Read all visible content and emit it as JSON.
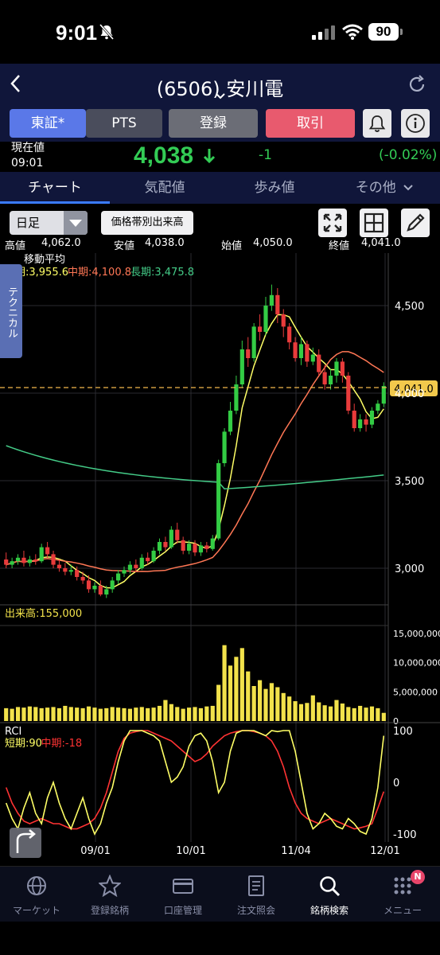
{
  "status": {
    "time": "9:01",
    "battery": "90"
  },
  "nav": {
    "title": "(6506) 安川電"
  },
  "buttons": {
    "tosho": "東証*",
    "pts": "PTS",
    "register": "登録",
    "trade": "取引"
  },
  "quote": {
    "label": "現在値",
    "time": "09:01",
    "price": "4,038",
    "change": "-1",
    "change_pct": "(-0.02%)"
  },
  "tabs": [
    "チャート",
    "気配値",
    "歩み値",
    "その他"
  ],
  "toolbar": {
    "period": "日足",
    "volume_profile": "価格帯別出来高"
  },
  "ohlc": {
    "high_label": "高値",
    "high": "4,062.0",
    "low_label": "安値",
    "low": "4,038.0",
    "open_label": "始値",
    "open": "4,050.0",
    "close_label": "終値",
    "close": "4,041.0"
  },
  "side_tab": "テクニカル",
  "chart_data": {
    "type": "candlestick",
    "ma_title": "移動平均",
    "ma_legend": [
      {
        "label": "短期:3,955.6",
        "color": "#ffff66"
      },
      {
        "label": "中期:4,100.8",
        "color": "#ff7755"
      },
      {
        "label": "長期:3,475.8",
        "color": "#44cc88"
      }
    ],
    "price_axis": [
      "4,500",
      "4,000",
      "3,500",
      "3,000"
    ],
    "price_range": [
      2800,
      4800
    ],
    "current_price_tag": "4,041.0",
    "x_labels": [
      "09/01",
      "10/01",
      "11/04",
      "12/01"
    ],
    "candles": [
      [
        3050,
        3020,
        3090,
        3000
      ],
      [
        3020,
        3040,
        3060,
        3000
      ],
      [
        3040,
        3060,
        3080,
        3020
      ],
      [
        3060,
        3030,
        3100,
        3010
      ],
      [
        3030,
        3050,
        3070,
        3010
      ],
      [
        3050,
        3040,
        3080,
        3020
      ],
      [
        3040,
        3120,
        3140,
        3030
      ],
      [
        3120,
        3080,
        3150,
        3060
      ],
      [
        3080,
        3020,
        3100,
        3000
      ],
      [
        3020,
        3000,
        3050,
        2980
      ],
      [
        3000,
        2980,
        3030,
        2960
      ],
      [
        2980,
        2990,
        3020,
        2960
      ],
      [
        2990,
        2950,
        3010,
        2930
      ],
      [
        2950,
        2930,
        2980,
        2910
      ],
      [
        2930,
        2880,
        2960,
        2860
      ],
      [
        2880,
        2900,
        2920,
        2860
      ],
      [
        2900,
        2850,
        2930,
        2840
      ],
      [
        2850,
        2880,
        2900,
        2830
      ],
      [
        2880,
        2930,
        2950,
        2860
      ],
      [
        2930,
        2970,
        2990,
        2910
      ],
      [
        2970,
        2990,
        3010,
        2950
      ],
      [
        2990,
        3020,
        3040,
        2970
      ],
      [
        3020,
        3000,
        3050,
        2980
      ],
      [
        3000,
        3060,
        3080,
        2990
      ],
      [
        3060,
        3040,
        3090,
        3020
      ],
      [
        3040,
        3100,
        3120,
        3030
      ],
      [
        3100,
        3150,
        3170,
        3080
      ],
      [
        3150,
        3120,
        3180,
        3100
      ],
      [
        3120,
        3220,
        3240,
        3110
      ],
      [
        3220,
        3160,
        3260,
        3140
      ],
      [
        3160,
        3100,
        3180,
        3080
      ],
      [
        3100,
        3140,
        3160,
        3080
      ],
      [
        3140,
        3090,
        3160,
        3070
      ],
      [
        3090,
        3130,
        3150,
        3070
      ],
      [
        3130,
        3110,
        3150,
        3090
      ],
      [
        3110,
        3170,
        3190,
        3100
      ],
      [
        3170,
        3600,
        3620,
        3160
      ],
      [
        3600,
        3780,
        3800,
        3580
      ],
      [
        3780,
        3900,
        3950,
        3760
      ],
      [
        3900,
        4050,
        4100,
        3880
      ],
      [
        4050,
        4250,
        4300,
        4030
      ],
      [
        4250,
        4200,
        4320,
        4150
      ],
      [
        4200,
        4380,
        4400,
        4180
      ],
      [
        4380,
        4350,
        4450,
        4300
      ],
      [
        4350,
        4500,
        4550,
        4330
      ],
      [
        4500,
        4560,
        4620,
        4470
      ],
      [
        4560,
        4450,
        4600,
        4400
      ],
      [
        4450,
        4380,
        4480,
        4320
      ],
      [
        4380,
        4290,
        4400,
        4250
      ],
      [
        4290,
        4200,
        4320,
        4180
      ],
      [
        4200,
        4280,
        4320,
        4160
      ],
      [
        4280,
        4180,
        4300,
        4150
      ],
      [
        4180,
        4220,
        4260,
        4160
      ],
      [
        4220,
        4120,
        4250,
        4100
      ],
      [
        4120,
        4050,
        4160,
        4020
      ],
      [
        4050,
        4100,
        4140,
        4020
      ],
      [
        4100,
        4180,
        4200,
        4060
      ],
      [
        4180,
        4100,
        4200,
        4060
      ],
      [
        4100,
        3900,
        4120,
        3880
      ],
      [
        3900,
        3800,
        3940,
        3780
      ],
      [
        3800,
        3850,
        3880,
        3780
      ],
      [
        3850,
        3820,
        3880,
        3780
      ],
      [
        3820,
        3900,
        3920,
        3800
      ],
      [
        3900,
        3940,
        3960,
        3880
      ],
      [
        3940,
        4041,
        4062,
        3920
      ]
    ],
    "volume_label": "出来高:155,000",
    "volume_axis": [
      "15,000,000",
      "10,000,000",
      "5,000,000",
      "0"
    ],
    "volume_max": 15000000,
    "rci_label": "RCI",
    "rci_legend": [
      {
        "label": "短期:90",
        "color": "#ffff66"
      },
      {
        "label": "中期:-18",
        "color": "#ff3333"
      }
    ],
    "rci_axis": [
      "100",
      "0",
      "-100"
    ]
  },
  "bottom_nav": [
    {
      "label": "マーケット",
      "icon": "globe-icon"
    },
    {
      "label": "登録銘柄",
      "icon": "star-icon"
    },
    {
      "label": "口座管理",
      "icon": "card-icon"
    },
    {
      "label": "注文照会",
      "icon": "document-icon"
    },
    {
      "label": "銘柄検索",
      "icon": "search-icon"
    },
    {
      "label": "メニュー",
      "icon": "menu-grid-icon",
      "badge": "N"
    }
  ]
}
